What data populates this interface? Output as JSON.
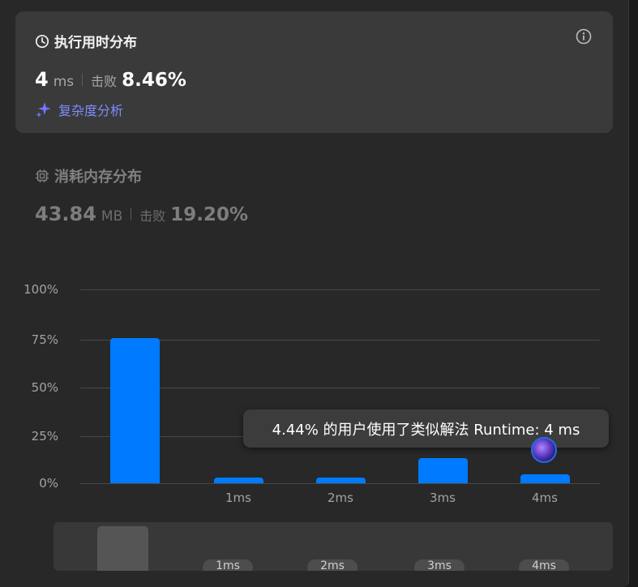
{
  "runtime": {
    "title": "执行用时分布",
    "value": "4",
    "unit": "ms",
    "beat_label": "击败",
    "beat_value": "8.46%",
    "complexity_link": "复杂度分析"
  },
  "memory": {
    "title": "消耗内存分布",
    "value": "43.84",
    "unit": "MB",
    "beat_label": "击败",
    "beat_value": "19.20%"
  },
  "chart_data": {
    "type": "bar",
    "categories": [
      "",
      "1ms",
      "2ms",
      "3ms",
      "4ms"
    ],
    "values": [
      75,
      3,
      3,
      13,
      4.44
    ],
    "y_ticks": [
      "100%",
      "75%",
      "50%",
      "25%",
      "0%"
    ],
    "ylim": [
      0,
      100
    ],
    "grid": true,
    "bar_color": "#007aff"
  },
  "tooltip": {
    "text": "4.44% 的用户使用了类似解法 Runtime: 4 ms"
  },
  "brush": {
    "labels": [
      "1ms",
      "2ms",
      "3ms",
      "4ms"
    ]
  },
  "colors": {
    "accent": "#007aff",
    "link": "#7f8cff"
  },
  "icons": {
    "runtime": "clock-icon",
    "info": "info-icon",
    "complexity": "sparkle-icon",
    "memory": "chip-icon"
  }
}
